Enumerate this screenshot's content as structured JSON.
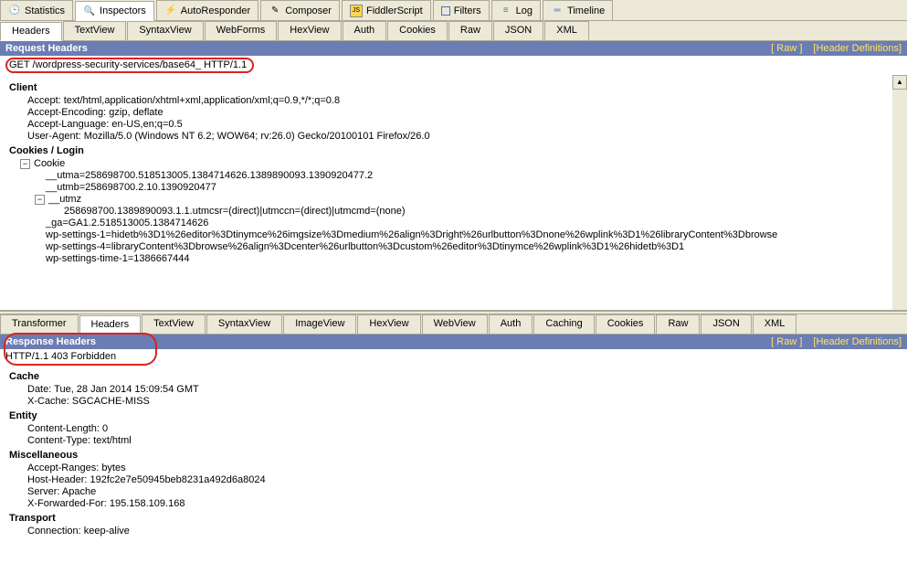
{
  "mainTabs": {
    "statistics": "Statistics",
    "inspectors": "Inspectors",
    "autoResponder": "AutoResponder",
    "composer": "Composer",
    "fiddlerScript": "FiddlerScript",
    "filters": "Filters",
    "log": "Log",
    "timeline": "Timeline"
  },
  "reqTabs": {
    "headers": "Headers",
    "textView": "TextView",
    "syntaxView": "SyntaxView",
    "webForms": "WebForms",
    "hexView": "HexView",
    "auth": "Auth",
    "cookies": "Cookies",
    "raw": "Raw",
    "json": "JSON",
    "xml": "XML"
  },
  "reqHeader": {
    "title": "Request Headers",
    "rawLink": "[ Raw ]",
    "defsLink": "[Header Definitions]"
  },
  "requestLine": "GET /wordpress-security-services/base64_ HTTP/1.1",
  "client": {
    "title": "Client",
    "accept": "Accept: text/html,application/xhtml+xml,application/xml;q=0.9,*/*;q=0.8",
    "acceptEncoding": "Accept-Encoding: gzip, deflate",
    "acceptLanguage": "Accept-Language: en-US,en;q=0.5",
    "userAgent": "User-Agent: Mozilla/5.0 (Windows NT 6.2; WOW64; rv:26.0) Gecko/20100101 Firefox/26.0"
  },
  "cookies": {
    "title": "Cookies / Login",
    "cookieLabel": "Cookie",
    "utma": "__utma=258698700.518513005.1384714626.1389890093.1390920477.2",
    "utmb": "__utmb=258698700.2.10.1390920477",
    "utmzLabel": "__utmz",
    "utmzValue": "258698700.1389890093.1.1.utmcsr=(direct)|utmccn=(direct)|utmcmd=(none)",
    "ga": "_ga=GA1.2.518513005.1384714626",
    "wpSettings1": "wp-settings-1=hidetb%3D1%26editor%3Dtinymce%26imgsize%3Dmedium%26align%3Dright%26urlbutton%3Dnone%26wplink%3D1%26libraryContent%3Dbrowse",
    "wpSettings4": "wp-settings-4=libraryContent%3Dbrowse%26align%3Dcenter%26urlbutton%3Dcustom%26editor%3Dtinymce%26wplink%3D1%26hidetb%3D1",
    "wpSettingsTime": "wp-settings-time-1=1386667444"
  },
  "respTabs": {
    "transformer": "Transformer",
    "headers": "Headers",
    "textView": "TextView",
    "syntaxView": "SyntaxView",
    "imageView": "ImageView",
    "hexView": "HexView",
    "webView": "WebView",
    "auth": "Auth",
    "caching": "Caching",
    "cookies": "Cookies",
    "raw": "Raw",
    "json": "JSON",
    "xml": "XML"
  },
  "respHeader": {
    "title": "Response Headers",
    "rawLink": "[ Raw ]",
    "defsLink": "[Header Definitions]"
  },
  "responseStatus": "HTTP/1.1 403 Forbidden",
  "cache": {
    "title": "Cache",
    "date": "Date: Tue, 28 Jan 2014 15:09:54 GMT",
    "xcache": "X-Cache: SGCACHE-MISS"
  },
  "entity": {
    "title": "Entity",
    "contentLength": "Content-Length: 0",
    "contentType": "Content-Type: text/html"
  },
  "misc": {
    "title": "Miscellaneous",
    "acceptRanges": "Accept-Ranges: bytes",
    "hostHeader": "Host-Header: 192fc2e7e50945beb8231a492d6a8024",
    "server": "Server: Apache",
    "xforwarded": "X-Forwarded-For: 195.158.109.168"
  },
  "transport": {
    "title": "Transport",
    "connection": "Connection: keep-alive"
  }
}
